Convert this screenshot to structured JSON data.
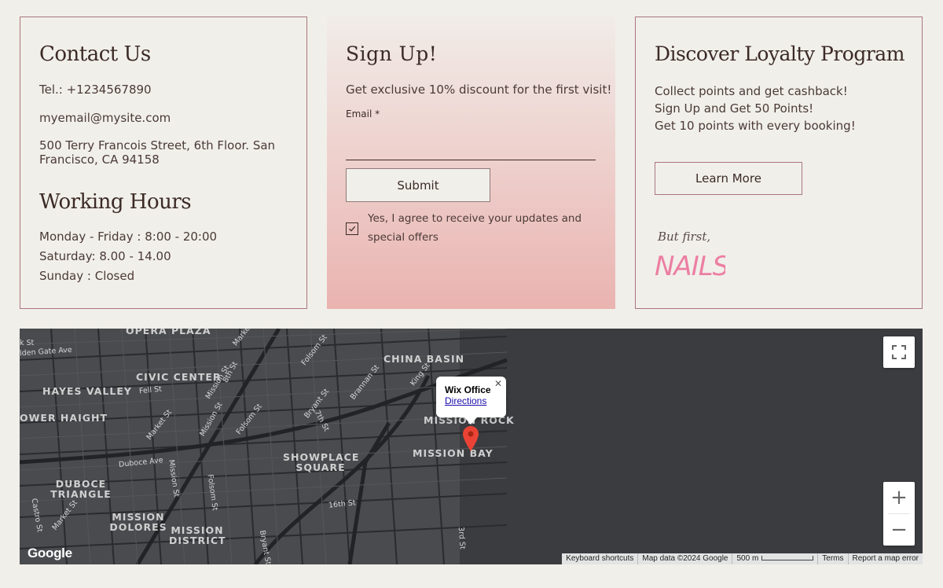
{
  "contact": {
    "title": "Contact Us",
    "tel": "Tel.: +1234567890",
    "email": "myemail@mysite.com",
    "address": "500 Terry Francois Street, 6th Floor. San Francisco, CA 94158",
    "hours_title": "Working Hours",
    "hours": [
      "Monday - Friday : 8:00 - 20:00",
      "Saturday: 8.00 - 14.00",
      "Sunday : Closed"
    ]
  },
  "signup": {
    "title": "Sign Up!",
    "subtitle": "Get exclusive 10% discount for the first visit!",
    "email_label": "Email *",
    "email_value": "",
    "submit_label": "Submit",
    "checkbox_checked": true,
    "consent": "Yes, I agree to receive your updates and special offers"
  },
  "loyalty": {
    "title": "Discover Loyalty Program",
    "lines": [
      "Collect points and get cashback!",
      "Sign Up and Get 50 Points!",
      "Get 10 points with every booking!"
    ],
    "button_label": "Learn More",
    "logo_text": [
      "But first,",
      "NAILS"
    ]
  },
  "map": {
    "districts": [
      "OPERA PLAZA",
      "CIVIC CENTER",
      "HAYES VALLEY",
      "OWER HAIGHT",
      "DUBOCE TRIANGLE",
      "MISSION DOLORES",
      "MISSION DISTRICT",
      "SHOWPLACE SQUARE",
      "MISSION BAY",
      "CHINA BASIN",
      "MISSION ROCK"
    ],
    "streets": [
      "k St",
      "lden Gate Ave",
      "Fell St",
      "Market St",
      "Duboce Ave",
      "Castro St",
      "Market St",
      "Folsom St",
      "Mission St",
      "8th St",
      "Mission St",
      "Folsom St",
      "Bryant St",
      "7th St",
      "Brannan St",
      "King St",
      "Folsom St",
      "Mission St",
      "16th St",
      "Bryant St",
      "3rd St",
      "Marke"
    ],
    "info_title": "Wix Office",
    "info_link": "Directions",
    "zoom_in": "+",
    "zoom_out": "−",
    "google": "Google",
    "attribution": [
      "Keyboard shortcuts",
      "Map data ©2024 Google",
      "500 m",
      "Terms",
      "Report a map error"
    ]
  },
  "colors": {
    "background": "#f1efea",
    "border": "#a9777c",
    "text": "#3b2a26",
    "map": "#3b3c40",
    "pin": "#ea4335"
  }
}
